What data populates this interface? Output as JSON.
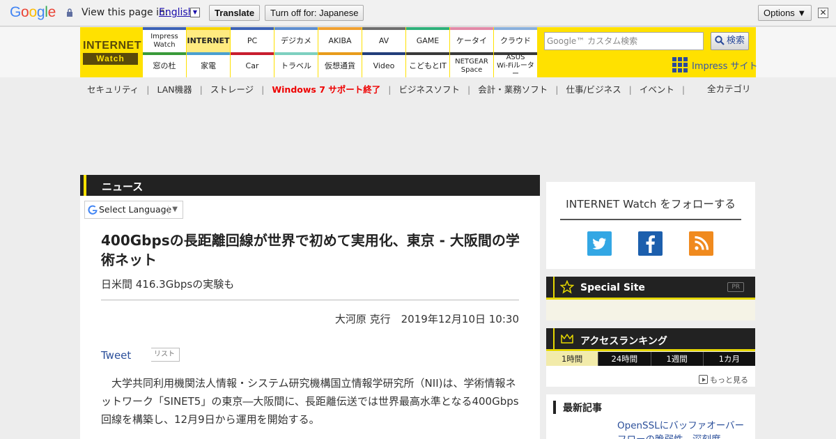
{
  "translate_bar": {
    "logo": "Google",
    "prompt": "View this page in:",
    "language": "English",
    "language_dropdown": "▼",
    "translate_button": "Translate",
    "turn_off_button": "Turn off for: Japanese",
    "options_button": "Options ▼",
    "close": "✕"
  },
  "header": {
    "logo_top": "INTERNET",
    "logo_bottom": "Watch",
    "nav_row1": [
      {
        "label": "Impress\nWatch",
        "color": "#3c62b5"
      },
      {
        "label": "INTERNET",
        "color": "#f6d400",
        "active": true
      },
      {
        "label": "PC",
        "color": "#3c62b5"
      },
      {
        "label": "デジカメ",
        "color": "#5e8ecf"
      },
      {
        "label": "AKIBA",
        "color": "#f0a030"
      },
      {
        "label": "AV",
        "color": "#6e6e6e"
      },
      {
        "label": "GAME",
        "color": "#2eb07a"
      },
      {
        "label": "ケータイ",
        "color": "#e28aa8"
      },
      {
        "label": "クラウド",
        "color": "#8ab0dc"
      }
    ],
    "nav_row2": [
      {
        "label": "窓の杜",
        "color": "#3a9a3a"
      },
      {
        "label": "家電",
        "color": "#4aa0d0"
      },
      {
        "label": "Car",
        "color": "#c81e2e"
      },
      {
        "label": "トラベル",
        "color": "#7ed0c0"
      },
      {
        "label": "仮想通貨",
        "color": "#e89c1c"
      },
      {
        "label": "Video",
        "color": "#233e7a"
      },
      {
        "label": "こどもとIT",
        "color": "#3a3a3a"
      },
      {
        "label": "NETGEAR\nSpace",
        "color": "#3a3a3a"
      },
      {
        "label": "ASUS\nWi-Fiルーター",
        "color": "#3a3a3a"
      }
    ],
    "search_placeholder": "Google™ カスタム検索",
    "search_button": "検索",
    "impress_site": "Impress サイト"
  },
  "categories": {
    "items": [
      "セキュリティ",
      "LAN機器",
      "ストレージ",
      "Windows 7 サポート終了",
      "ビジネスソフト",
      "会計・業務ソフト",
      "仕事/ビジネス",
      "イベント"
    ],
    "separator": "|",
    "all": "全カテゴリ"
  },
  "article": {
    "section": "ニュース",
    "select_language": "Select Language",
    "select_arrow": "▼",
    "headline": "400Gbpsの長距離回線が世界で初めて実用化、東京 - 大阪間の学術ネット",
    "subhead": "日米間 416.3Gbpsの実験も",
    "byline": "大河原 克行　2019年12月10日 10:30",
    "tweet": "Tweet",
    "list": "リスト",
    "body": "大学共同利用機関法人情報・システム研究機構国立情報学研究所（NII)は、学術情報ネットワーク「SINET5」の東京―大阪間に、長距離伝送では世界最高水準となる400Gbps回線を構築し、12月9日から運用を開始する。"
  },
  "sidebar": {
    "follow_title": "INTERNET Watch をフォローする",
    "social": [
      "twitter-icon",
      "facebook-icon",
      "rss-icon"
    ],
    "special_site": "Special Site",
    "pr": "PR",
    "ranking_title": "アクセスランキング",
    "ranking_tabs": [
      "1時間",
      "24時間",
      "1週間",
      "1カ月"
    ],
    "more": "もっと見る",
    "latest_title": "最新記事",
    "latest_item": "OpenSSLにバッファオーバーフローの脆弱性　深刻度"
  }
}
